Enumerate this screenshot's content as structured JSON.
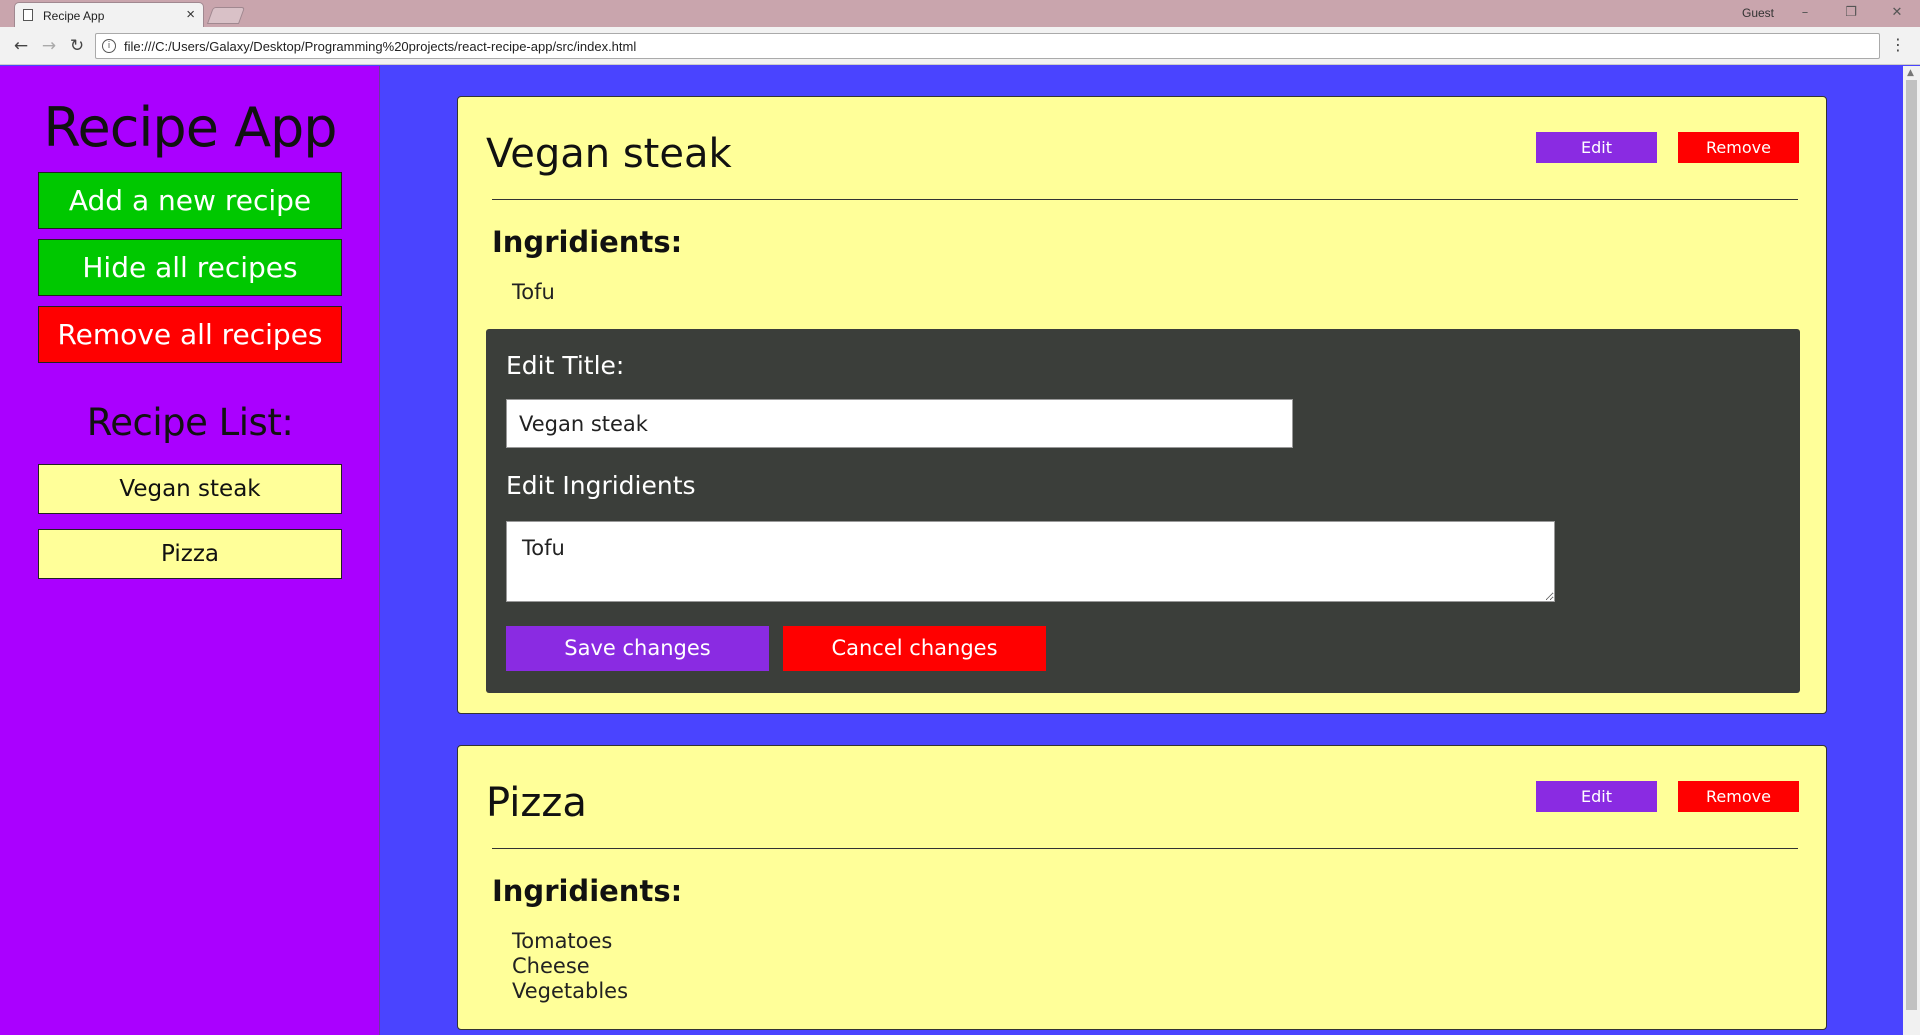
{
  "browser": {
    "tab_title": "Recipe App",
    "tab_close": "×",
    "profile": "Guest",
    "url": "file:///C:/Users/Galaxy/Desktop/Programming%20projects/react-recipe-app/src/index.html",
    "window_buttons": {
      "minimize": "–",
      "restore": "❐",
      "close": "✕"
    },
    "nav": {
      "back": "←",
      "forward": "→",
      "reload": "↻"
    },
    "menu": "⋮",
    "info": "i"
  },
  "sidebar": {
    "title": "Recipe App",
    "buttons": {
      "add": "Add a new recipe",
      "hide": "Hide all recipes",
      "remove_all": "Remove all recipes"
    },
    "list_title": "Recipe List:",
    "recipes": [
      "Vegan steak",
      "Pizza"
    ]
  },
  "recipes": [
    {
      "title": "Vegan steak",
      "edit_label": "Edit",
      "remove_label": "Remove",
      "ingredients_heading": "Ingridients:",
      "ingredients": [
        "Tofu"
      ],
      "editor": {
        "title_label": "Edit Title:",
        "title_value": "Vegan steak",
        "ingredients_label": "Edit Ingridients",
        "ingredients_value": "Tofu",
        "save_label": "Save changes",
        "cancel_label": "Cancel changes"
      }
    },
    {
      "title": "Pizza",
      "edit_label": "Edit",
      "remove_label": "Remove",
      "ingredients_heading": "Ingridients:",
      "ingredients": [
        "Tomatoes",
        "Cheese",
        "Vegetables"
      ]
    }
  ],
  "colors": {
    "sidebar_bg": "#aa00ff",
    "main_bg": "#4a44ff",
    "card_bg": "#ffff99",
    "green": "#00c800",
    "red": "#ff0000",
    "purple": "#8a2be2",
    "panel_bg": "#3b3e3a"
  }
}
